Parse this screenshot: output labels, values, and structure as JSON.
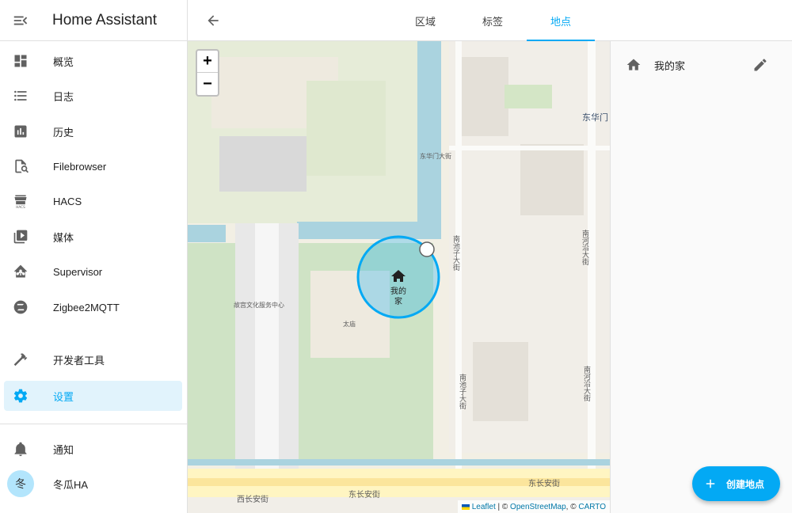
{
  "sidebar": {
    "title": "Home Assistant",
    "items": [
      {
        "label": "概览",
        "icon": "view-dashboard-icon"
      },
      {
        "label": "日志",
        "icon": "format-list-bulleted-icon"
      },
      {
        "label": "历史",
        "icon": "chart-box-icon"
      },
      {
        "label": "Filebrowser",
        "icon": "file-search-icon"
      },
      {
        "label": "HACS",
        "icon": "hacs-icon"
      },
      {
        "label": "媒体",
        "icon": "play-box-multiple-icon"
      },
      {
        "label": "Supervisor",
        "icon": "home-assistant-icon"
      },
      {
        "label": "Zigbee2MQTT",
        "icon": "zigbee-icon"
      }
    ],
    "dev_tools": "开发者工具",
    "settings": "设置",
    "notifications": "通知",
    "user": {
      "name": "冬瓜HA",
      "initial": "冬"
    }
  },
  "tabs": [
    {
      "label": "区域",
      "active": false
    },
    {
      "label": "标签",
      "active": false
    },
    {
      "label": "地点",
      "active": true
    }
  ],
  "map": {
    "zoom_in": "+",
    "zoom_out": "−",
    "home_zone_label_1": "我的",
    "home_zone_label_2": "家",
    "streets": {
      "a": "东华门",
      "b": "东华门大街",
      "c": "南池子大街",
      "d": "南河沿大街",
      "e": "故宫文化服务中心",
      "f": "太庙",
      "g": "南池子大街",
      "h": "东长安街",
      "i": "西长安街",
      "j": "东长安街",
      "k": "南河沿大街"
    },
    "attribution": {
      "leaflet": "Leaflet",
      "sep1": " | © ",
      "osm": "OpenStreetMap",
      "sep2": ", © ",
      "carto": "CARTO"
    }
  },
  "panel": {
    "zones": [
      {
        "name": "我的家",
        "icon": "home-icon"
      }
    ],
    "create_button": "创建地点"
  },
  "colors": {
    "accent": "#03a9f4",
    "active_bg": "#e1f3fc"
  }
}
